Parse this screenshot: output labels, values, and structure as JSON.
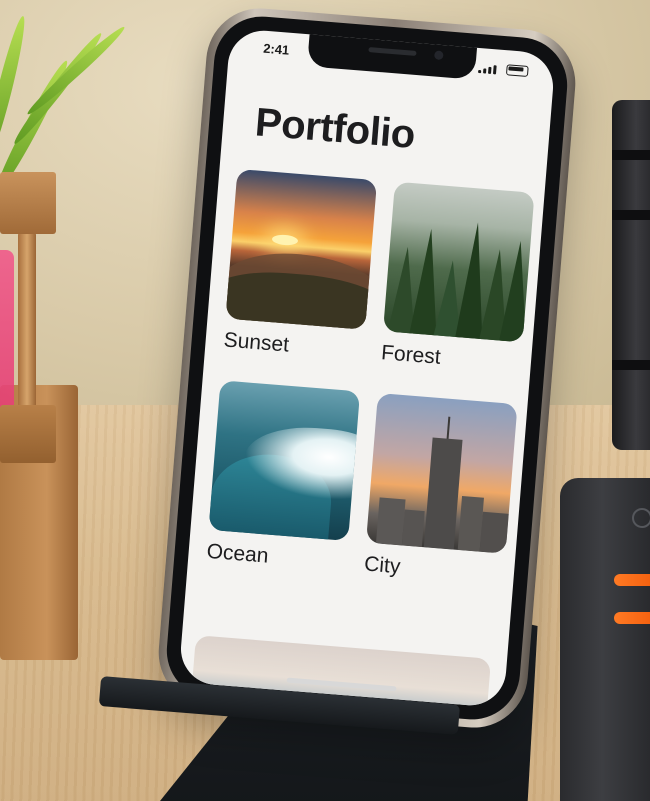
{
  "status_bar": {
    "time": "2:41"
  },
  "screen": {
    "title": "Portfolio",
    "tiles": [
      {
        "label": "Sunset"
      },
      {
        "label": "Forest"
      },
      {
        "label": "Ocean"
      },
      {
        "label": "City"
      }
    ]
  },
  "icons": {
    "signal": "cellular-signal-icon",
    "battery": "battery-icon"
  },
  "colors": {
    "screen_bg": "#f4f3f1",
    "text": "#1d1d1f",
    "charger_led": "#f25d0c"
  }
}
